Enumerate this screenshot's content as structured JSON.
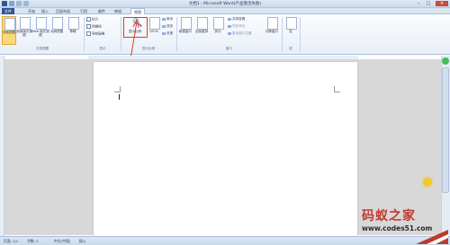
{
  "window": {
    "title": "文档1 - Microsoft Word(产品激活失败)",
    "controls": [
      "–",
      "□",
      "✕"
    ]
  },
  "tabs": [
    "文件",
    "开始",
    "插入",
    "页面布局",
    "引用",
    "邮件",
    "审阅",
    "视图"
  ],
  "ribbon": {
    "views": {
      "buttons": [
        "页面视图",
        "阅读版式视图",
        "Web 版式视图",
        "大纲视图",
        "草稿"
      ],
      "group_label": "文档视图"
    },
    "show": {
      "checks": [
        "标尺",
        "网格线",
        "导航窗格"
      ],
      "group_label": "显示"
    },
    "zoom": {
      "buttons": [
        "显示比例",
        "100%"
      ],
      "small": [
        "单页",
        "双页",
        "页宽"
      ],
      "group_label": "显示比例"
    },
    "window": {
      "buttons": [
        "新建窗口",
        "全部重排",
        "拆分"
      ],
      "small": [
        "并排查看",
        "同步滚动",
        "重设窗口位置"
      ],
      "switch": "切换窗口",
      "group_label": "窗口"
    },
    "macro": {
      "button": "宏",
      "group_label": "宏"
    }
  },
  "status": {
    "page": "页面: 1/1",
    "words": "字数: 0",
    "lang": "中文(中国)",
    "mode": "插入"
  },
  "watermark": {
    "title": "码蚁之家",
    "url": "www.codes51.com"
  },
  "colors": {
    "highlight": "#e23b2b",
    "accent": "#2b5797",
    "watermark_red": "#c0392b"
  }
}
